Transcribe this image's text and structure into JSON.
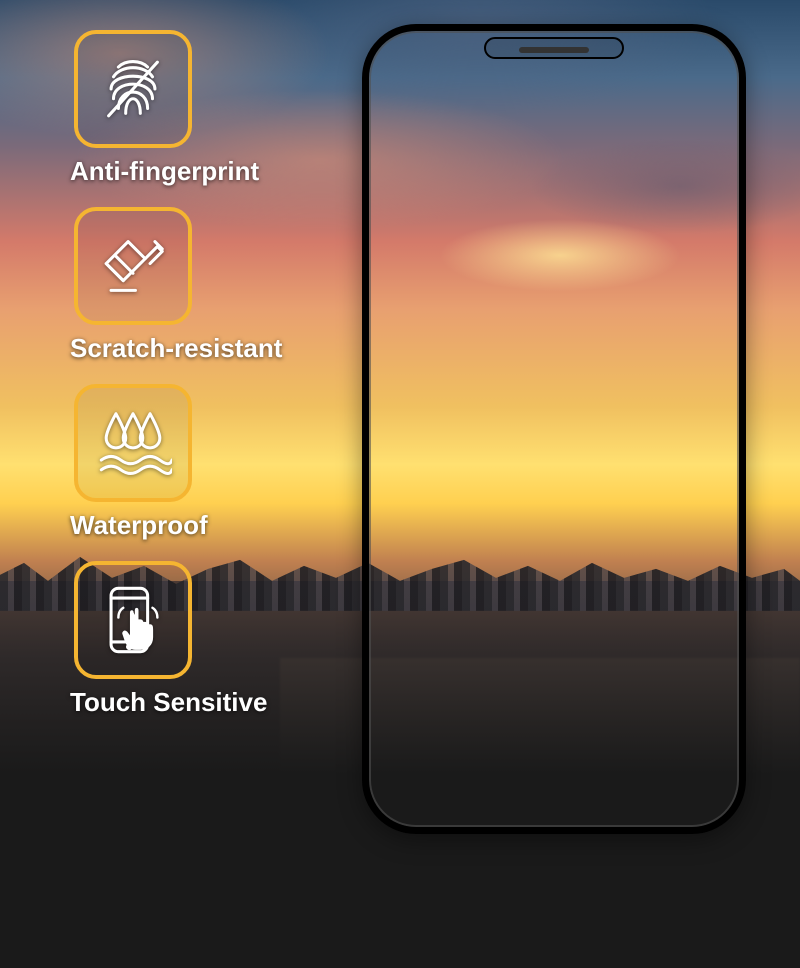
{
  "features": [
    {
      "label": "Anti-fingerprint",
      "icon": "fingerprint-slash-icon"
    },
    {
      "label": "Scratch-resistant",
      "icon": "scratch-resistant-icon"
    },
    {
      "label": "Waterproof",
      "icon": "waterproof-icon"
    },
    {
      "label": "Touch Sensitive",
      "icon": "touch-sensitive-icon"
    }
  ],
  "colors": {
    "icon_border": "#f5b531",
    "text": "#ffffff"
  }
}
